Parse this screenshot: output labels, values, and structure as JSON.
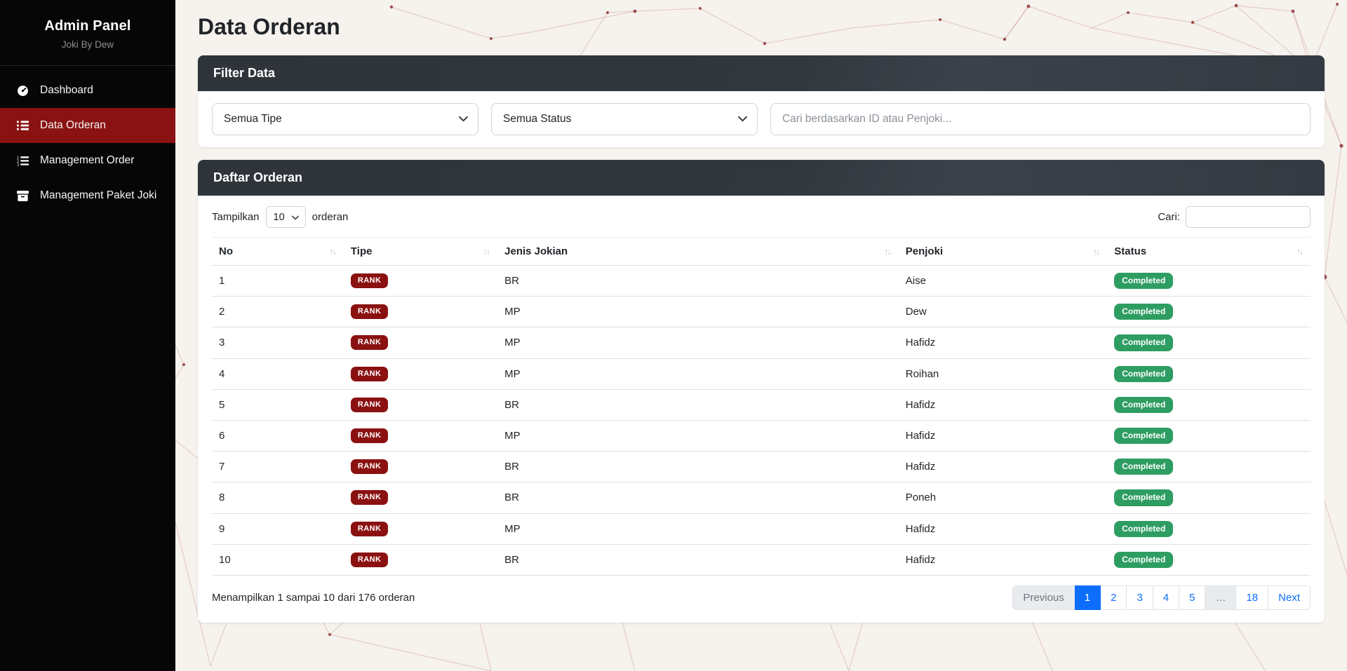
{
  "colors": {
    "background": "#f6f2ed",
    "sidebar_bg": "#060606",
    "accent_red": "#8b1212",
    "card_header_dark": "#343a40",
    "success_green": "#2e9d62",
    "pagination_blue": "#0d6efd"
  },
  "sidebar": {
    "title": "Admin Panel",
    "subtitle": "Joki By Dew",
    "items": [
      {
        "label": "Dashboard",
        "icon": "gauge-icon",
        "active": false
      },
      {
        "label": "Data Orderan",
        "icon": "list-icon",
        "active": true
      },
      {
        "label": "Management Order",
        "icon": "list-ol-icon",
        "active": false
      },
      {
        "label": "Management Paket Joki",
        "icon": "box-icon",
        "active": false
      }
    ]
  },
  "page": {
    "title": "Data Orderan"
  },
  "filter_card": {
    "header": "Filter Data",
    "tipe_value": "Semua Tipe",
    "status_value": "Semua Status",
    "search_placeholder": "Cari berdasarkan ID atau Penjoki..."
  },
  "table_card": {
    "header": "Daftar Orderan",
    "length_before": "Tampilkan",
    "length_value": "10",
    "length_after": "orderan",
    "search_label": "Cari:",
    "columns": [
      "No",
      "Tipe",
      "Jenis Jokian",
      "Penjoki",
      "Status"
    ],
    "rows": [
      {
        "no": "1",
        "tipe": "RANK",
        "jenis": "BR",
        "penjoki": "Aise",
        "status": "Completed"
      },
      {
        "no": "2",
        "tipe": "RANK",
        "jenis": "MP",
        "penjoki": "Dew",
        "status": "Completed"
      },
      {
        "no": "3",
        "tipe": "RANK",
        "jenis": "MP",
        "penjoki": "Hafidz",
        "status": "Completed"
      },
      {
        "no": "4",
        "tipe": "RANK",
        "jenis": "MP",
        "penjoki": "Roihan",
        "status": "Completed"
      },
      {
        "no": "5",
        "tipe": "RANK",
        "jenis": "BR",
        "penjoki": "Hafidz",
        "status": "Completed"
      },
      {
        "no": "6",
        "tipe": "RANK",
        "jenis": "MP",
        "penjoki": "Hafidz",
        "status": "Completed"
      },
      {
        "no": "7",
        "tipe": "RANK",
        "jenis": "BR",
        "penjoki": "Hafidz",
        "status": "Completed"
      },
      {
        "no": "8",
        "tipe": "RANK",
        "jenis": "BR",
        "penjoki": "Poneh",
        "status": "Completed"
      },
      {
        "no": "9",
        "tipe": "RANK",
        "jenis": "MP",
        "penjoki": "Hafidz",
        "status": "Completed"
      },
      {
        "no": "10",
        "tipe": "RANK",
        "jenis": "BR",
        "penjoki": "Hafidz",
        "status": "Completed"
      }
    ],
    "info": "Menampilkan 1 sampai 10 dari 176 orderan",
    "pagination": [
      {
        "label": "Previous",
        "state": "disabled"
      },
      {
        "label": "1",
        "state": "active"
      },
      {
        "label": "2",
        "state": "link"
      },
      {
        "label": "3",
        "state": "link"
      },
      {
        "label": "4",
        "state": "link"
      },
      {
        "label": "5",
        "state": "link"
      },
      {
        "label": "…",
        "state": "disabled"
      },
      {
        "label": "18",
        "state": "link"
      },
      {
        "label": "Next",
        "state": "link"
      }
    ]
  },
  "icons": {
    "sort_glyph": "↑↓"
  }
}
